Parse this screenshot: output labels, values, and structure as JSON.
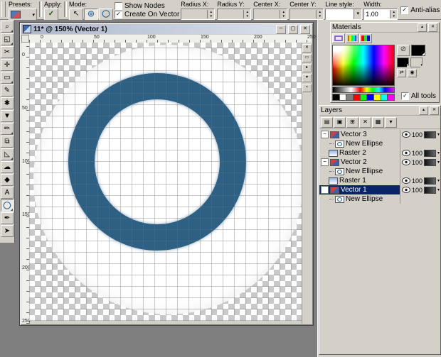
{
  "icons": {
    "check": "✓",
    "dropdown": "▾",
    "up": "▴",
    "close": "✕",
    "minimize": "─",
    "maximize": "▢",
    "arrow_mode": "↖",
    "circle_mode": "◎",
    "ellipse_mode": "◯",
    "null": "⊘",
    "swap": "⇄",
    "target": "◉"
  },
  "toolbar": {
    "presets_label": "Presets:",
    "apply_label": "Apply:",
    "mode_label": "Mode:",
    "show_nodes_label": "Show Nodes",
    "create_on_vector_label": "Create On Vector",
    "fields": [
      {
        "label": "Radius X:",
        "value": ""
      },
      {
        "label": "Radius Y:",
        "value": ""
      },
      {
        "label": "Center X:",
        "value": ""
      },
      {
        "label": "Center Y:",
        "value": ""
      }
    ],
    "line_style_label": "Line style:",
    "width_label": "Width:",
    "width_value": "1.00",
    "antialias_label": "Anti-alias",
    "antialias_checked": true
  },
  "tools": {
    "items": [
      {
        "name": "zoom-tool",
        "glyph": "⌕",
        "flyout": true
      },
      {
        "name": "deform-tool",
        "glyph": "◱",
        "flyout": true
      },
      {
        "name": "crop-tool",
        "glyph": "✂"
      },
      {
        "name": "move-tool",
        "glyph": "✛"
      },
      {
        "name": "selection-tool",
        "glyph": "▭",
        "flyout": true
      },
      {
        "name": "freehand-selection-tool",
        "glyph": "✎"
      },
      {
        "name": "magic-wand-tool",
        "glyph": "✱"
      },
      {
        "name": "dropper-tool",
        "glyph": "▼"
      },
      {
        "name": "paintbrush-tool",
        "glyph": "✏",
        "flyout": true
      },
      {
        "name": "clone-brush-tool",
        "glyph": "⧉"
      },
      {
        "name": "eraser-tool",
        "glyph": "◺",
        "flyout": true
      },
      {
        "name": "airbrush-tool",
        "glyph": "☁"
      },
      {
        "name": "flood-fill-tool",
        "glyph": "◆"
      },
      {
        "name": "text-tool",
        "glyph": "A"
      },
      {
        "name": "preset-shapes-tool",
        "glyph": "◯",
        "selected": true,
        "flyout": true
      },
      {
        "name": "pen-tool",
        "glyph": "✒"
      },
      {
        "name": "object-selector-tool",
        "glyph": "➤"
      }
    ]
  },
  "canvas_window": {
    "title": "11* @ 150% (Vector 1)",
    "ruler_h": [
      "0",
      "50",
      "100",
      "150",
      "200",
      "250"
    ],
    "ruler_v": [
      "0",
      "50",
      "100",
      "150",
      "200",
      "250"
    ],
    "ring_color": "#2d6083",
    "edge_buttons": [
      {
        "name": "edge-close-button",
        "glyph": "✕"
      },
      {
        "name": "edge-restore-button",
        "glyph": "▭"
      },
      {
        "name": "edge-expand-button",
        "glyph": "▸"
      },
      {
        "name": "edge-collapse-button",
        "glyph": "▾"
      },
      {
        "name": "edge-misc-button",
        "glyph": "▪"
      }
    ]
  },
  "materials": {
    "title": "Materials",
    "all_tools_label": "All tools",
    "all_tools_checked": true,
    "swatches": [
      "#000000",
      "#ffffff",
      "#808080",
      "#ff0000",
      "#00ff00",
      "#0000ff",
      "#ffff00",
      "#00ffff",
      "#ff00ff"
    ]
  },
  "layers": {
    "title": "Layers",
    "toolbar": [
      {
        "name": "new-raster-layer-button",
        "glyph": "▤"
      },
      {
        "name": "new-vector-layer-button",
        "glyph": "▣"
      },
      {
        "name": "new-layer-group-button",
        "glyph": "⊞"
      },
      {
        "name": "delete-layer-button",
        "glyph": "✕"
      },
      {
        "name": "edit-selection-button",
        "glyph": "▦"
      },
      {
        "name": "layer-options-button",
        "glyph": "▾"
      }
    ],
    "items": [
      {
        "name": "Vector 3",
        "kind": "vector",
        "opacity": "100"
      },
      {
        "name": "New Ellipse",
        "kind": "ellipse",
        "sub": true
      },
      {
        "name": "Raster 2",
        "kind": "raster",
        "opacity": "100"
      },
      {
        "name": "Vector 2",
        "kind": "vector",
        "opacity": "100"
      },
      {
        "name": "New Ellipse",
        "kind": "ellipse",
        "sub": true
      },
      {
        "name": "Raster 1",
        "kind": "raster",
        "opacity": "100"
      },
      {
        "name": "Vector 1",
        "kind": "vector",
        "opacity": "100",
        "selected": true
      },
      {
        "name": "New Ellipse",
        "kind": "ellipse",
        "sub": true
      }
    ]
  }
}
